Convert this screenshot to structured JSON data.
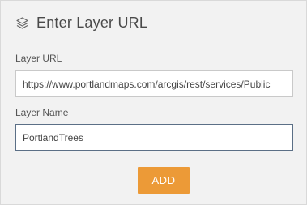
{
  "header": {
    "title": "Enter Layer URL",
    "icon": "layers-icon"
  },
  "form": {
    "url_label": "Layer URL",
    "url_value": "https://www.portlandmaps.com/arcgis/rest/services/Public",
    "name_label": "Layer Name",
    "name_value": "PortlandTrees"
  },
  "actions": {
    "add_label": "ADD"
  },
  "colors": {
    "accent": "#ec9a37",
    "focus_border": "#5b6f86"
  }
}
